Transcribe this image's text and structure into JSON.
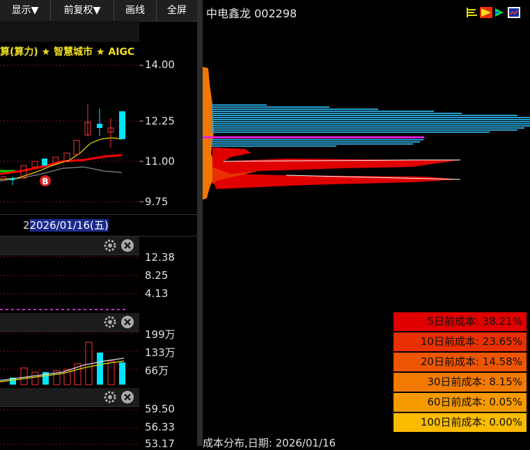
{
  "toolbar": {
    "display_label": "显示▼",
    "adjust_label": "前复权▼",
    "draw_label": "画线",
    "fullscreen_label": "全屏"
  },
  "concepts_text": "算(算力) ★  智慧城市 ★  AIGC",
  "price_axis": [
    "14.00",
    "12.25",
    "11.00",
    "9.75"
  ],
  "date_label_prefix": "2",
  "date_label_highlight": "2026/01/16(五)",
  "indicator1_axis": [
    "12.38",
    "8.25",
    "4.13"
  ],
  "volume_axis": [
    "199万",
    "133万",
    "66万"
  ],
  "indicator3_axis": [
    "59.50",
    "56.33",
    "53.17"
  ],
  "stock": {
    "name": "中电鑫龙",
    "code": "002298"
  },
  "chip_legend": [
    {
      "label": "5日前成本: 38.21%",
      "color": "#e00000"
    },
    {
      "label": "10日前成本: 23.65%",
      "color": "#e83000"
    },
    {
      "label": "20日前成本: 14.58%",
      "color": "#ee5500"
    },
    {
      "label": "30日前成本: 8.15%",
      "color": "#f37a00"
    },
    {
      "label": "60日前成本: 0.05%",
      "color": "#f79a00"
    },
    {
      "label": "100日前成本: 0.00%",
      "color": "#fbbc00"
    }
  ],
  "footer_label": "成本分布,日期: 2026/01/16",
  "colors": {
    "up": "#ff3232",
    "down": "#00e5ff",
    "ma_red": "#ff0000",
    "ma_yellow": "#e8e000",
    "chip_blue": "#2aa0d0",
    "chip_magenta": "#e020e0",
    "chip_orange": "#f07800"
  }
}
